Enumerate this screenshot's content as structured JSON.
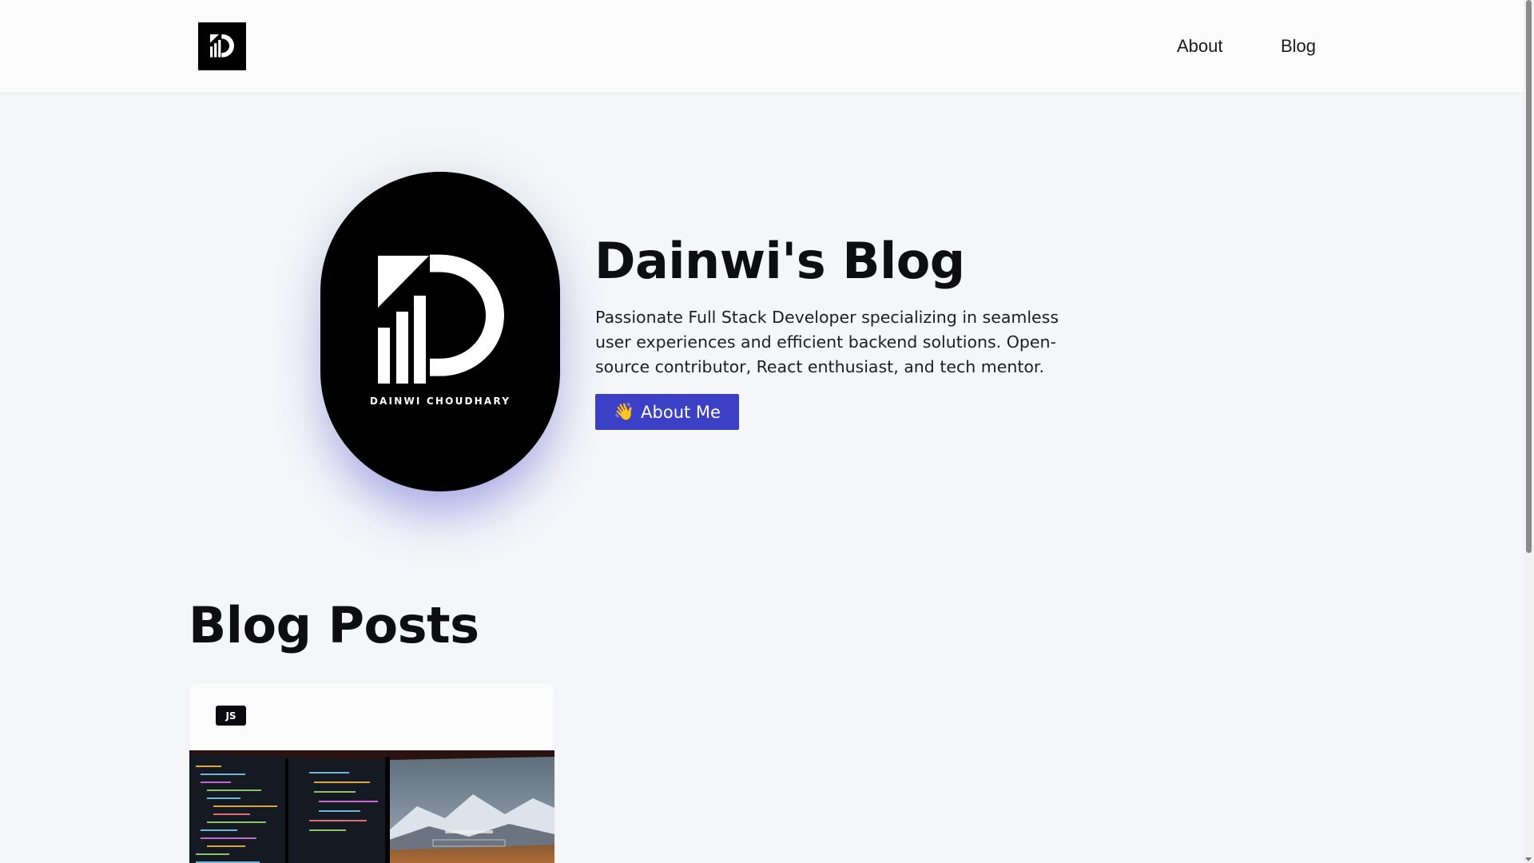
{
  "nav": {
    "about_label": "About",
    "blog_label": "Blog"
  },
  "hero": {
    "avatar_name": "DAINWI CHOUDHARY",
    "title": "Dainwi's Blog",
    "description": "Passionate Full Stack Developer specializing in seamless user experiences and efficient backend solutions. Open-source contributor, React enthusiast, and tech mentor.",
    "button_icon": "👋",
    "button_label": "About Me"
  },
  "blog": {
    "section_title": "Blog Posts",
    "posts": [
      {
        "tag": "JS"
      }
    ]
  },
  "colors": {
    "accent": "#3b40c6",
    "background": "#f5f6f9",
    "header_bg": "#fbfbfb",
    "logo_bg": "#000000"
  }
}
